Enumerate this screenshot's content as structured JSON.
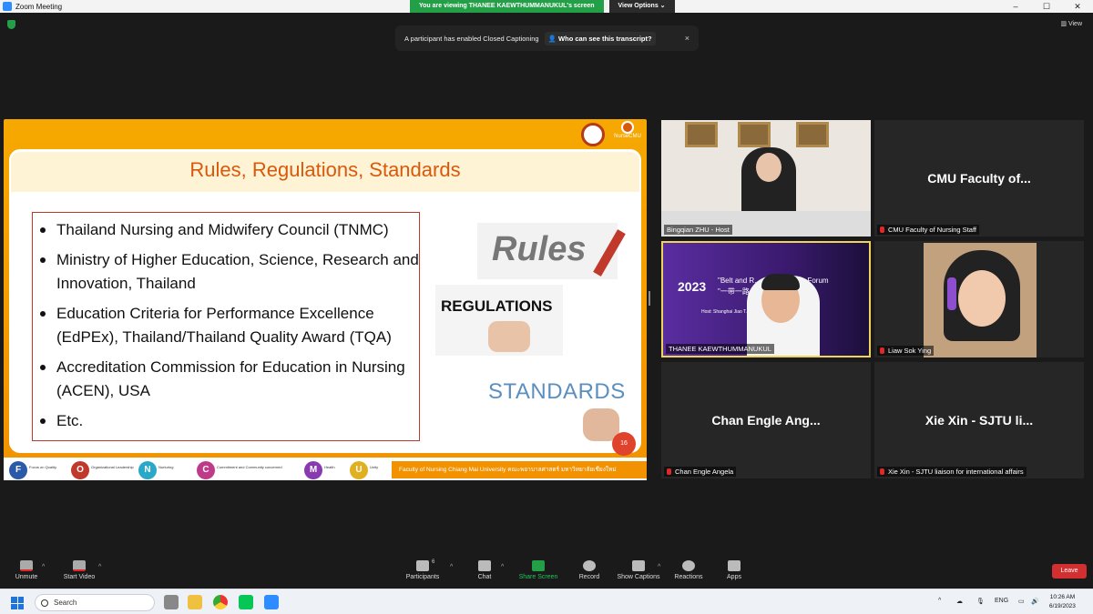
{
  "window": {
    "title": "Zoom Meeting",
    "controls": [
      "–",
      "☐",
      "✕"
    ]
  },
  "viewing": {
    "text": "You are viewing THANEE KAEWTHUMMANUKUL's screen",
    "options": "View Options ⌄"
  },
  "view_button": "View",
  "banner": {
    "text": "A participant has enabled Closed Captioning",
    "link": "Who can see this transcript?",
    "close": "×"
  },
  "slide": {
    "title": "Rules, Regulations, Standards",
    "logo_text": "NurseCMU",
    "bullets": [
      "Thailand Nursing and Midwifery Council (TNMC)",
      "Ministry of Higher Education, Science, Research and Innovation, Thailand",
      "Education Criteria for Performance Excellence (EdPEx), Thailand/Thailand Quality Award (TQA)",
      "Accreditation Commission for Education in Nursing (ACEN), USA",
      "Etc."
    ],
    "img_rules": "Rules",
    "img_regulations": "REGULATIONS",
    "img_standards": "STANDARDS",
    "page_number": "16",
    "footer_text": "Faculty of Nursing Chiang Mai University คณะพยาบาลศาสตร์ มหาวิทยาลัยเชียงใหม่",
    "footer_icons": [
      {
        "letter": "F",
        "text": "Focus on Quality",
        "color": "#2a5aa8"
      },
      {
        "letter": "O",
        "text": "Organizational Leadership",
        "color": "#c0392b"
      },
      {
        "letter": "N",
        "text": "Nurturing",
        "color": "#2aa8c8"
      },
      {
        "letter": "C",
        "text": "Commitment and Community concerned",
        "color": "#c03a8a"
      },
      {
        "letter": "M",
        "text": "Health",
        "color": "#8a3ab0"
      },
      {
        "letter": "U",
        "text": "Unity",
        "color": "#e0b020"
      }
    ]
  },
  "gallery": [
    {
      "name": "",
      "label": "Bingqian ZHU - Host",
      "muted": false
    },
    {
      "name": "CMU Faculty of...",
      "label": "CMU Faculty of Nursing Staff",
      "muted": true
    },
    {
      "name": "",
      "label": "THANEE KAEWTHUMMANUKUL",
      "muted": false,
      "year": "2023",
      "forum": "\"Belt and R... ursing Deans Forum\n\"一带一路... 院长论坛",
      "host": "Host: Shanghai Jiao T... chool of Nursing  主办方:上... 学院"
    },
    {
      "name": "",
      "label": "Liaw Sok Ying",
      "muted": true
    },
    {
      "name": "Chan Engle Ang...",
      "label": "Chan Engle Angela",
      "muted": true
    },
    {
      "name": "Xie Xin - SJTU li...",
      "label": "Xie Xin - SJTU liaison for international affairs",
      "muted": true
    }
  ],
  "toolbar": {
    "unmute": "Unmute",
    "start_video": "Start Video",
    "participants": "Participants",
    "participants_count": "6",
    "chat": "Chat",
    "share_screen": "Share Screen",
    "record": "Record",
    "show_captions": "Show Captions",
    "reactions": "Reactions",
    "apps": "Apps",
    "leave": "Leave"
  },
  "taskbar": {
    "search_placeholder": "Search",
    "lang": "ENG",
    "time": "10:26 AM",
    "date": "6/19/2023"
  }
}
